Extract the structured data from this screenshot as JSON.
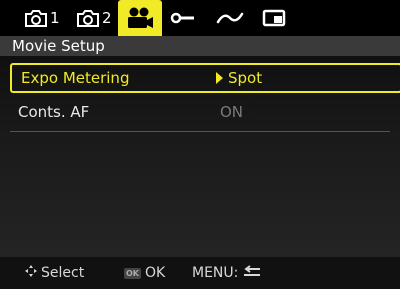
{
  "tabs": [
    {
      "icon": "camera-icon",
      "number": "1"
    },
    {
      "icon": "camera-icon",
      "number": "2"
    },
    {
      "icon": "movie-camera-icon",
      "number": ""
    },
    {
      "icon": "wrench-icon",
      "number": ""
    },
    {
      "icon": "wave-icon",
      "number": ""
    },
    {
      "icon": "playback-icon",
      "number": ""
    }
  ],
  "title": "Movie Setup",
  "menu": {
    "items": [
      {
        "label": "Expo Metering",
        "value": "Spot"
      },
      {
        "label": "Conts. AF",
        "value": "ON"
      }
    ]
  },
  "footer": {
    "select_label": "Select",
    "ok_badge": "OK",
    "ok_label": "OK",
    "menu_label": "MENU:"
  },
  "colors": {
    "accent": "#f0ea27",
    "title_bg": "#3a3a3a",
    "disabled_value": "#7a7a7a"
  }
}
